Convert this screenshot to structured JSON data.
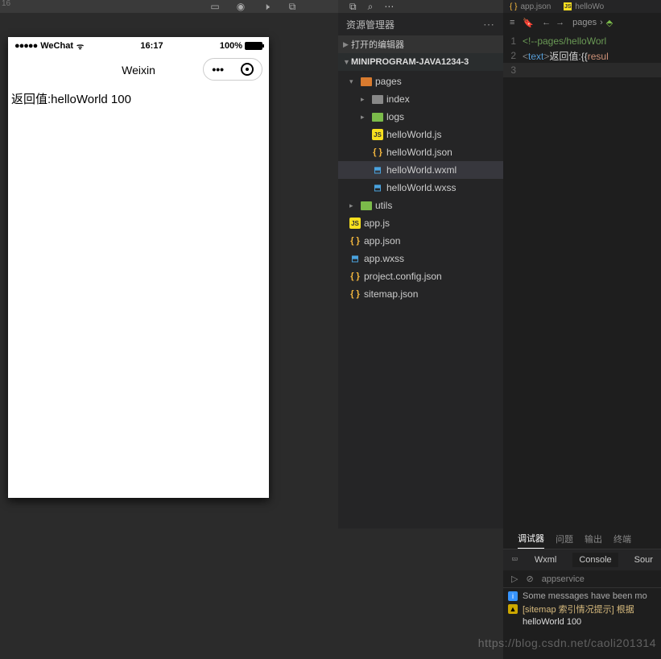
{
  "top_toolbar": {
    "label": "16"
  },
  "simulator": {
    "status": {
      "carrier": "WeChat",
      "time": "16:17",
      "battery_pct": "100%"
    },
    "nav_title": "Weixin",
    "page_text": "返回值:helloWorld 100"
  },
  "explorer": {
    "title": "资源管理器",
    "sections": {
      "open_editors": "打开的编辑器",
      "project": "MINIPROGRAM-JAVA1234-3"
    },
    "tree": {
      "pages": "pages",
      "index": "index",
      "logs": "logs",
      "hw_js": "helloWorld.js",
      "hw_json": "helloWorld.json",
      "hw_wxml": "helloWorld.wxml",
      "hw_wxss": "helloWorld.wxss",
      "utils": "utils",
      "app_js": "app.js",
      "app_json": "app.json",
      "app_wxss": "app.wxss",
      "proj_conf": "project.config.json",
      "sitemap": "sitemap.json"
    }
  },
  "editor": {
    "tabs": {
      "app_json": "app.json",
      "hello": "helloWo"
    },
    "crumb": {
      "root": "pages"
    },
    "code": {
      "l1": "<!--pages/helloWorl",
      "l2a": "<",
      "l2b": "text",
      "l2c": ">",
      "l2d": "返回值:",
      "l2e": "{{",
      "l2f": "resul"
    }
  },
  "console": {
    "tabs": {
      "debugger": "调试器",
      "problems": "问题",
      "output": "输出",
      "terminal": "终端"
    },
    "subtabs": {
      "wxml": "Wxml",
      "console": "Console",
      "sour": "Sour"
    },
    "filter": "appservice",
    "lines": {
      "l1": "Some messages have been mo",
      "l2": "[sitemap 索引情况提示] 根据",
      "l3": "helloWorld 100"
    }
  },
  "watermark": "https://blog.csdn.net/caoli201314"
}
